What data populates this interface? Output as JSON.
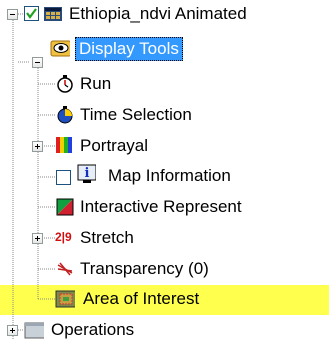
{
  "tree": {
    "root": {
      "label": "Ethiopia_ndvi  Animated",
      "checked": true,
      "icon": "layer-grid-icon"
    },
    "display_tools": {
      "label": "Display Tools",
      "icon": "eye-icon",
      "selected": true
    },
    "items": [
      {
        "label": "Run",
        "icon": "stopwatch-icon"
      },
      {
        "label": "Time Selection",
        "icon": "stopwatch-colored-icon"
      },
      {
        "label": "Portrayal",
        "icon": "color-bars-icon"
      },
      {
        "label": "Map Information",
        "icon": "info-icon"
      },
      {
        "label": "Interactive Represent",
        "icon": "representation-icon"
      },
      {
        "label": "Stretch",
        "icon": "stretch-icon",
        "icon_text": "2|9"
      },
      {
        "label": "Transparency (0)",
        "icon": "transparency-icon"
      },
      {
        "label": "Area of Interest",
        "icon": "area-of-interest-icon",
        "highlighted": true
      }
    ],
    "operations": {
      "label": "Operations",
      "icon": "folder-icon"
    }
  },
  "colors": {
    "selection": "#3399ff",
    "highlight": "#ffff4d"
  }
}
